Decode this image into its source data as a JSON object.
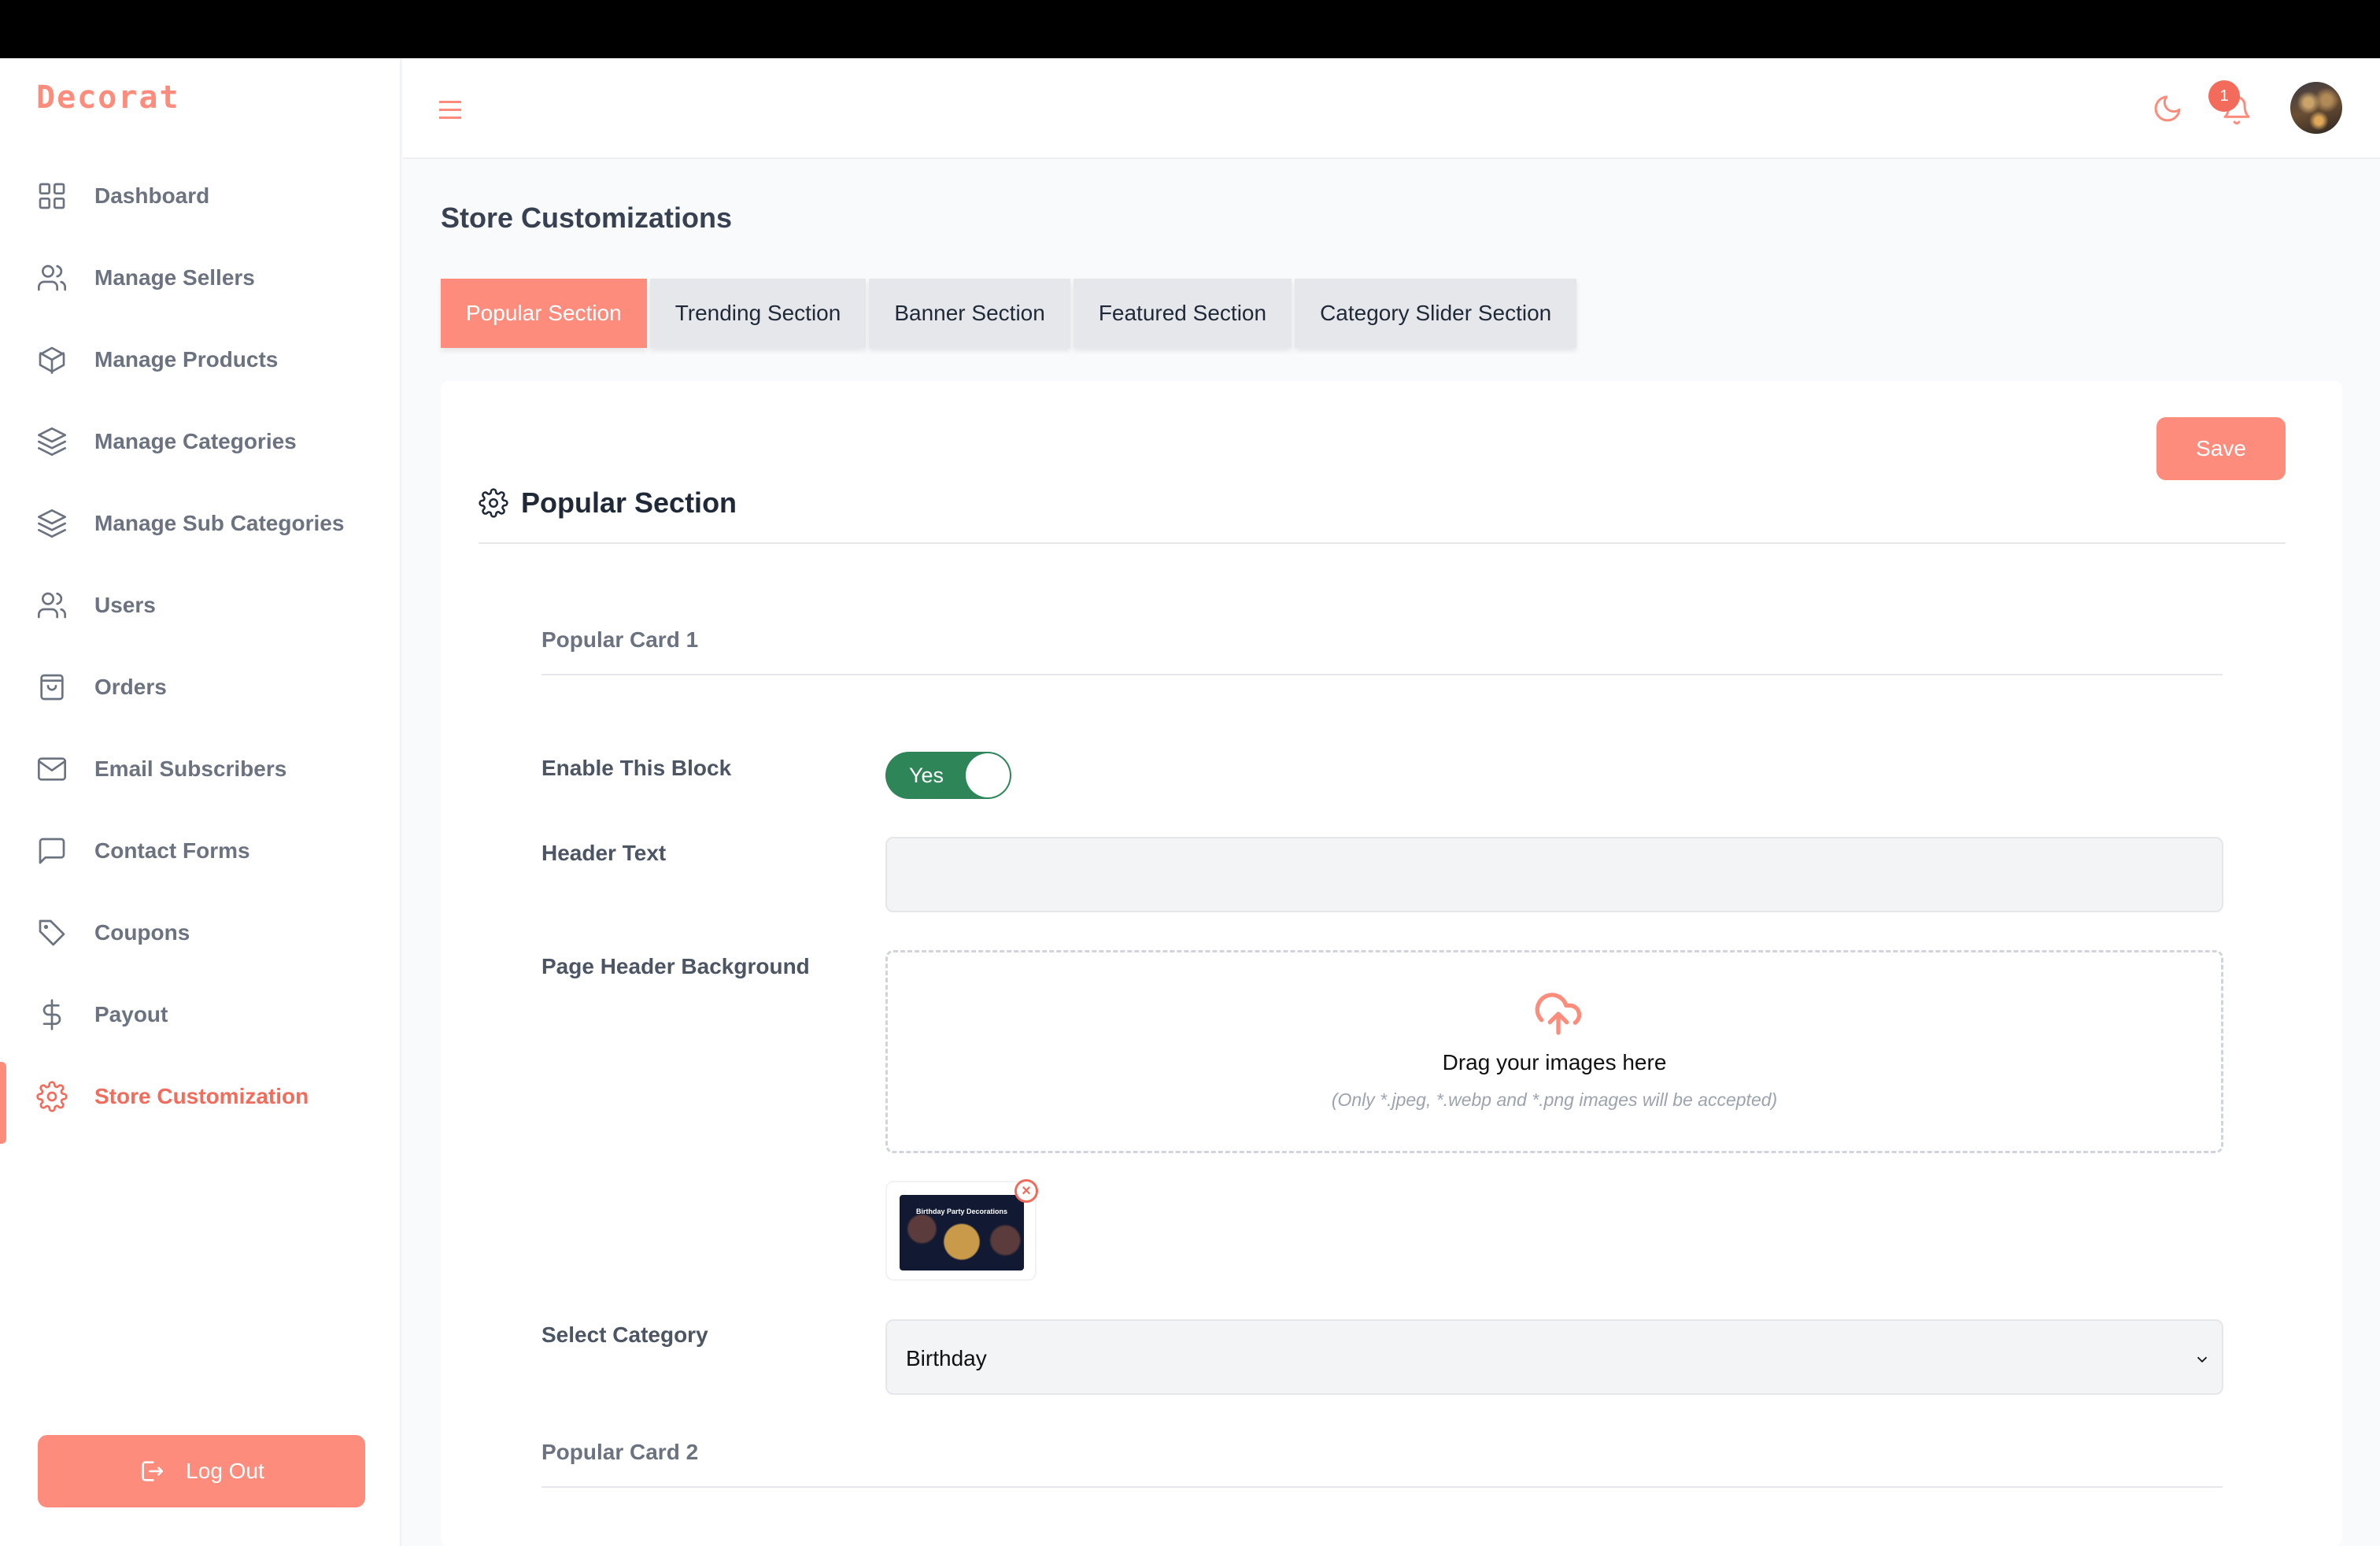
{
  "app": {
    "brand": "Decorat",
    "brand_color": "#fd8c7c"
  },
  "sidebar": {
    "items": [
      {
        "label": "Dashboard",
        "icon": "grid-icon",
        "active": false
      },
      {
        "label": "Manage Sellers",
        "icon": "users-icon",
        "active": false
      },
      {
        "label": "Manage Products",
        "icon": "box-icon",
        "active": false
      },
      {
        "label": "Manage Categories",
        "icon": "layers-icon",
        "active": false
      },
      {
        "label": "Manage Sub Categories",
        "icon": "layers-icon",
        "active": false
      },
      {
        "label": "Users",
        "icon": "users-icon",
        "active": false
      },
      {
        "label": "Orders",
        "icon": "shopping-bag-icon",
        "active": false
      },
      {
        "label": "Email Subscribers",
        "icon": "mail-icon",
        "active": false
      },
      {
        "label": "Contact Forms",
        "icon": "message-square-icon",
        "active": false
      },
      {
        "label": "Coupons",
        "icon": "tag-icon",
        "active": false
      },
      {
        "label": "Payout",
        "icon": "dollar-icon",
        "active": false
      },
      {
        "label": "Store Customization",
        "icon": "gear-icon",
        "active": true
      }
    ],
    "logout_label": "Log Out"
  },
  "header": {
    "notification_count": "1",
    "icons": [
      "menu-icon",
      "moon-icon",
      "bell-icon",
      "avatar"
    ]
  },
  "main": {
    "title": "Store Customizations",
    "tabs": [
      {
        "label": "Popular Section",
        "active": true
      },
      {
        "label": "Trending Section",
        "active": false
      },
      {
        "label": "Banner Section",
        "active": false
      },
      {
        "label": "Featured Section",
        "active": false
      },
      {
        "label": "Category Slider Section",
        "active": false
      }
    ],
    "save_label": "Save",
    "section_title": "Popular Section",
    "cards": [
      {
        "title": "Popular Card 1",
        "enable_label": "Enable This Block",
        "enable_value": "Yes",
        "enabled": true,
        "header_text_label": "Header Text",
        "header_text_value": "",
        "background_label": "Page Header Background",
        "dropzone_title": "Drag your images here",
        "dropzone_hint": "(Only *.jpeg, *.webp and *.png images will be accepted)",
        "uploaded_image_caption": "Birthday Party Decorations",
        "category_label": "Select Category",
        "category_value": "Birthday"
      },
      {
        "title": "Popular Card 2"
      }
    ]
  }
}
